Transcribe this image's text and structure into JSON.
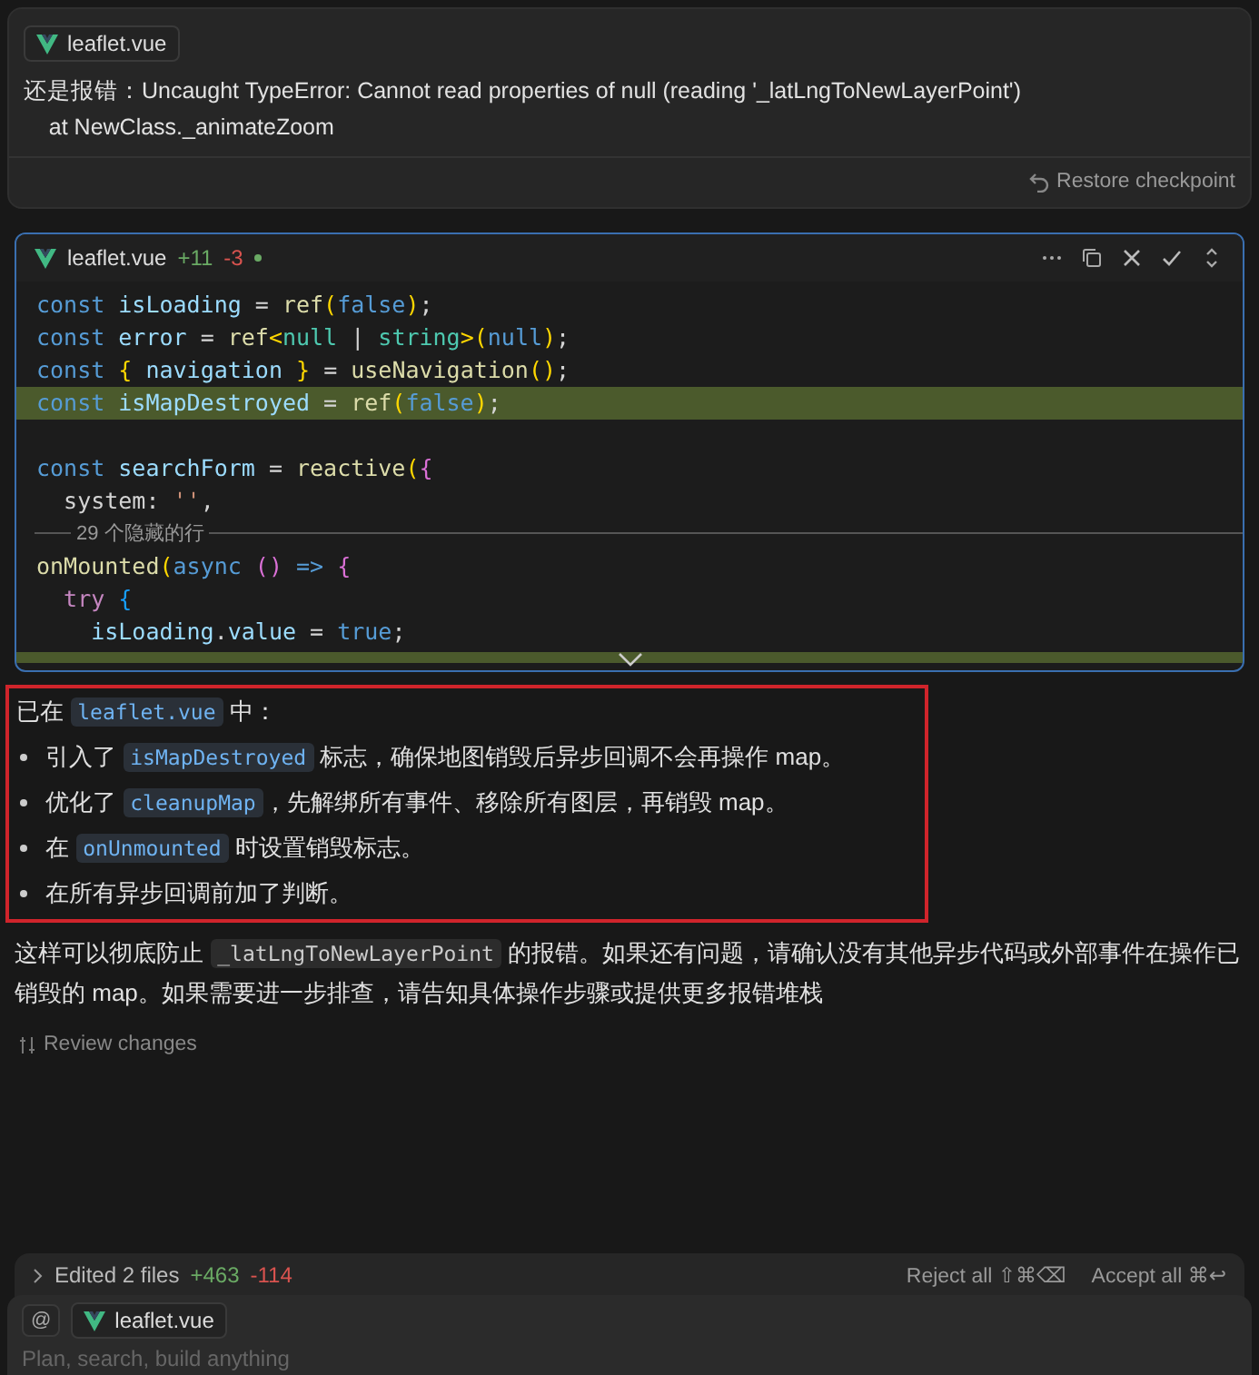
{
  "user_message": {
    "file_chip": "leaflet.vue",
    "lines": [
      "还是报错：Uncaught TypeError: Cannot read properties of null (reading '_latLngToNewLayerPoint')",
      "    at NewClass._animateZoom"
    ],
    "restore": "Restore checkpoint"
  },
  "diff_card": {
    "file": "leaflet.vue",
    "added": "+11",
    "removed": "-3",
    "unsaved": true,
    "lines": [
      {
        "added": false,
        "tokens": [
          {
            "kind": "kw",
            "text": "const "
          },
          {
            "kind": "var",
            "text": "isLoading"
          },
          {
            "kind": "op",
            "text": " = "
          },
          {
            "kind": "fn",
            "text": "ref"
          },
          {
            "kind": "p1",
            "text": "("
          },
          {
            "kind": "kw",
            "text": "false"
          },
          {
            "kind": "p1",
            "text": ")"
          },
          {
            "kind": "op",
            "text": ";"
          }
        ]
      },
      {
        "added": false,
        "tokens": [
          {
            "kind": "kw",
            "text": "const "
          },
          {
            "kind": "var",
            "text": "error"
          },
          {
            "kind": "op",
            "text": " = "
          },
          {
            "kind": "fn",
            "text": "ref"
          },
          {
            "kind": "p1",
            "text": "<"
          },
          {
            "kind": "type",
            "text": "null"
          },
          {
            "kind": "op",
            "text": " | "
          },
          {
            "kind": "type",
            "text": "string"
          },
          {
            "kind": "p1",
            "text": ">("
          },
          {
            "kind": "kw",
            "text": "null"
          },
          {
            "kind": "p1",
            "text": ")"
          },
          {
            "kind": "op",
            "text": ";"
          }
        ]
      },
      {
        "added": false,
        "tokens": [
          {
            "kind": "kw",
            "text": "const "
          },
          {
            "kind": "p1",
            "text": "{ "
          },
          {
            "kind": "var",
            "text": "navigation"
          },
          {
            "kind": "p1",
            "text": " }"
          },
          {
            "kind": "op",
            "text": " = "
          },
          {
            "kind": "fn",
            "text": "useNavigation"
          },
          {
            "kind": "p1",
            "text": "()"
          },
          {
            "kind": "op",
            "text": ";"
          }
        ]
      },
      {
        "added": true,
        "tokens": [
          {
            "kind": "kw",
            "text": "const "
          },
          {
            "kind": "var",
            "text": "isMapDestroyed"
          },
          {
            "kind": "op",
            "text": " = "
          },
          {
            "kind": "fn",
            "text": "ref"
          },
          {
            "kind": "p1",
            "text": "("
          },
          {
            "kind": "kw",
            "text": "false"
          },
          {
            "kind": "p1",
            "text": ")"
          },
          {
            "kind": "op",
            "text": ";"
          }
        ]
      },
      {
        "kind": "blank"
      },
      {
        "added": false,
        "tokens": [
          {
            "kind": "kw",
            "text": "const "
          },
          {
            "kind": "var",
            "text": "searchForm"
          },
          {
            "kind": "op",
            "text": " = "
          },
          {
            "kind": "fn",
            "text": "reactive"
          },
          {
            "kind": "p1",
            "text": "("
          },
          {
            "kind": "p2",
            "text": "{"
          }
        ]
      },
      {
        "added": false,
        "tokens": [
          {
            "kind": "op",
            "text": "  system: "
          },
          {
            "kind": "str",
            "text": "''"
          },
          {
            "kind": "op",
            "text": ","
          }
        ]
      },
      {
        "kind": "hidden",
        "text": "29 个隐藏的行"
      },
      {
        "added": false,
        "tokens": [
          {
            "kind": "fn",
            "text": "onMounted"
          },
          {
            "kind": "p1",
            "text": "("
          },
          {
            "kind": "kw",
            "text": "async"
          },
          {
            "kind": "p2",
            "text": " () "
          },
          {
            "kind": "kw",
            "text": "=>"
          },
          {
            "kind": "p2",
            "text": " {"
          }
        ]
      },
      {
        "added": false,
        "tokens": [
          {
            "kind": "kw2",
            "text": "  try"
          },
          {
            "kind": "p3",
            "text": " {"
          }
        ]
      },
      {
        "added": false,
        "tokens": [
          {
            "kind": "var",
            "text": "    isLoading"
          },
          {
            "kind": "op",
            "text": "."
          },
          {
            "kind": "var",
            "text": "value"
          },
          {
            "kind": "op",
            "text": " = "
          },
          {
            "kind": "kw",
            "text": "true"
          },
          {
            "kind": "op",
            "text": ";"
          }
        ]
      },
      {
        "added": true
      }
    ]
  },
  "answer": {
    "intro": [
      {
        "t": "已在 "
      },
      {
        "c": "leaflet.vue"
      },
      {
        "t": " 中："
      }
    ],
    "bullets": [
      [
        {
          "t": "引入了 "
        },
        {
          "c": "isMapDestroyed"
        },
        {
          "t": " 标志，确保地图销毁后异步回调不会再操作 map。"
        }
      ],
      [
        {
          "t": "优化了 "
        },
        {
          "c": "cleanupMap"
        },
        {
          "t": "，先解绑所有事件、移除所有图层，再销毁 map。"
        }
      ],
      [
        {
          "t": "在 "
        },
        {
          "c": "onUnmounted"
        },
        {
          "t": " 时设置销毁标志。"
        }
      ],
      [
        {
          "t": "在所有异步回调前加了判断。"
        }
      ]
    ],
    "summary": [
      {
        "t": "这样可以彻底防止 "
      },
      {
        "c": "_latLngToNewLayerPoint",
        "plain": true
      },
      {
        "t": " 的报错。如果还有问题，请确认没有其他异步代码或外部事件在操作已销毁的 map。如果需要进一步排查，请告知具体操作步骤或提供更多报错堆栈"
      }
    ],
    "review": "Review changes"
  },
  "edits_bar": {
    "label": "Edited 2 files",
    "added": "+463",
    "removed": "-114",
    "reject": "Reject all ⇧⌘⌫",
    "accept": "Accept all ⌘↩"
  },
  "composer": {
    "at": "@",
    "file_chip": "leaflet.vue",
    "placeholder": "Plan, search, build anything"
  }
}
